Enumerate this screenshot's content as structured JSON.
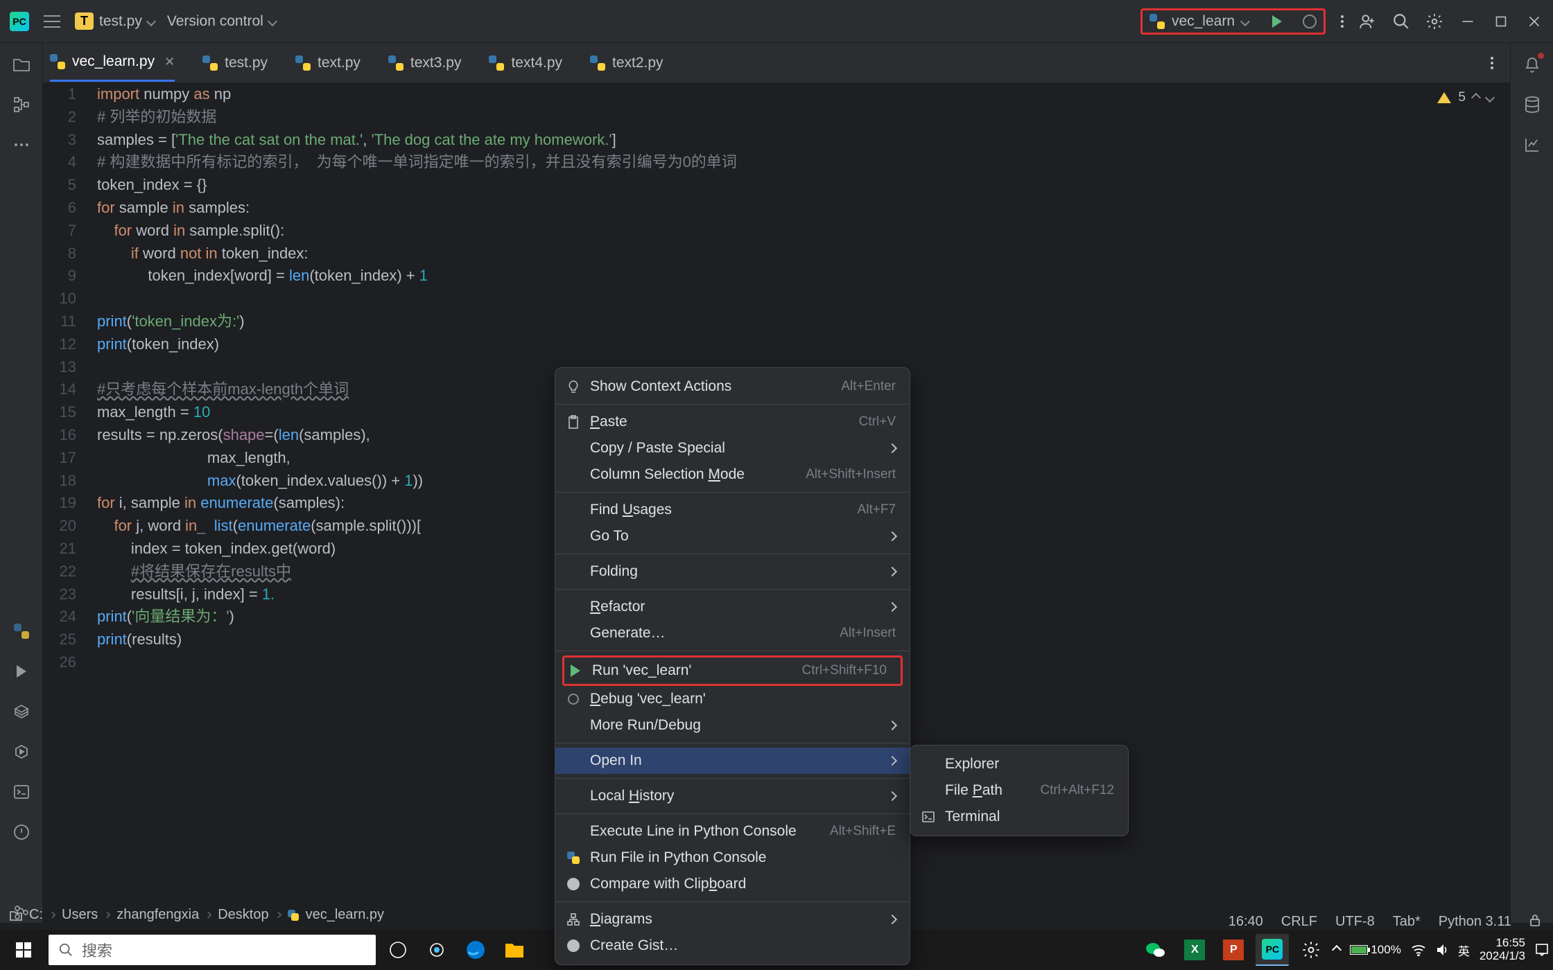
{
  "titlebar": {
    "project_badge": "T",
    "project_name": "test.py",
    "vcs_label": "Version control",
    "run_config": "vec_learn"
  },
  "tabs": [
    {
      "label": "vec_learn.py",
      "active": true
    },
    {
      "label": "test.py",
      "active": false
    },
    {
      "label": "text.py",
      "active": false
    },
    {
      "label": "text3.py",
      "active": false
    },
    {
      "label": "text4.py",
      "active": false
    },
    {
      "label": "text2.py",
      "active": false
    }
  ],
  "warnings": {
    "count": "5"
  },
  "code": {
    "lines": [
      {
        "n": "1",
        "html": "<span class='kw'>import</span> numpy <span class='kw'>as</span> np"
      },
      {
        "n": "2",
        "html": "<span class='cmt'># 列举的初始数据</span>"
      },
      {
        "n": "3",
        "html": "samples = [<span class='str'>'The the cat sat on the mat.'</span>, <span class='str'>'The dog cat the ate my homework.'</span>]"
      },
      {
        "n": "4",
        "html": "<span class='cmt'># 构建数据中所有标记的索引，  为每个唯一单词指定唯一的索引，并且没有索引编号为0的单词</span>"
      },
      {
        "n": "5",
        "html": "token_index = {}"
      },
      {
        "n": "6",
        "html": "<span class='kw'>for</span> sample <span class='kw'>in</span> samples:"
      },
      {
        "n": "7",
        "html": "    <span class='kw'>for</span> word <span class='kw'>in</span> sample.split():"
      },
      {
        "n": "8",
        "html": "        <span class='kw'>if</span> word <span class='kw'>not in</span> token_index:"
      },
      {
        "n": "9",
        "html": "            token_index[word] = <span class='fn'>len</span>(token_index) + <span class='num'>1</span>"
      },
      {
        "n": "10",
        "html": ""
      },
      {
        "n": "11",
        "html": "<span class='fn'>print</span>(<span class='str'>'token_index为:'</span>)"
      },
      {
        "n": "12",
        "html": "<span class='fn'>print</span>(token_index)"
      },
      {
        "n": "13",
        "html": ""
      },
      {
        "n": "14",
        "html": "<span class='cmt wavy'>#只考虑每个样本前max-length个单词</span>"
      },
      {
        "n": "15",
        "html": "max_length = <span class='num'>10</span>"
      },
      {
        "n": "16",
        "html": "results = np.zeros(<span style='color:#aa7ea3'>shape</span>=(<span class='fn'>len</span>(samples),",
        "hl": true
      },
      {
        "n": "17",
        "html": "                          max_length,"
      },
      {
        "n": "18",
        "html": "                          <span class='fn'>max</span>(token_index.values()) + <span class='num'>1</span>))"
      },
      {
        "n": "19",
        "html": "<span class='kw'>for</span> i, sample <span class='kw'>in</span> <span class='fn'>enumerate</span>(samples):"
      },
      {
        "n": "20",
        "html": "    <span class='kw'>for</span> j, word <span class='kw'>in</span><span class='cmt'>_</span>  <span class='fn'>list</span>(<span class='fn'>enumerate</span>(sample.split()))["
      },
      {
        "n": "21",
        "html": "        index = token_index.get(word)"
      },
      {
        "n": "22",
        "html": "        <span class='cmt wavy'>#将结果保存在results中</span>"
      },
      {
        "n": "23",
        "html": "        results[i, j, index] = <span class='num'>1.</span>"
      },
      {
        "n": "24",
        "html": "<span class='fn'>print</span>(<span class='str'>'向量结果为：'</span>)"
      },
      {
        "n": "25",
        "html": "<span class='fn'>print</span>(results)"
      },
      {
        "n": "26",
        "html": ""
      }
    ]
  },
  "context_menu": {
    "items": [
      {
        "type": "item",
        "icon": "bulb",
        "label": "Show Context Actions",
        "shortcut": "Alt+Enter"
      },
      {
        "type": "sep"
      },
      {
        "type": "item",
        "icon": "paste",
        "label_html": "<span class='u'>P</span>aste",
        "shortcut": "Ctrl+V"
      },
      {
        "type": "item",
        "label": "Copy / Paste Special",
        "arrow": true
      },
      {
        "type": "item",
        "label_html": "Column Selection <span class='u'>M</span>ode",
        "shortcut": "Alt+Shift+Insert"
      },
      {
        "type": "sep"
      },
      {
        "type": "item",
        "label_html": "Find <span class='u'>U</span>sages",
        "shortcut": "Alt+F7"
      },
      {
        "type": "item",
        "label": "Go To",
        "arrow": true
      },
      {
        "type": "sep"
      },
      {
        "type": "item",
        "label": "Folding",
        "arrow": true
      },
      {
        "type": "sep"
      },
      {
        "type": "item",
        "label_html": "<span class='u'>R</span>efactor",
        "arrow": true
      },
      {
        "type": "item",
        "label": "Generate…",
        "shortcut": "Alt+Insert"
      },
      {
        "type": "sep"
      },
      {
        "type": "run",
        "icon": "play",
        "label": "Run 'vec_learn'",
        "shortcut": "Ctrl+Shift+F10"
      },
      {
        "type": "item",
        "icon": "bug",
        "label_html": "<span class='u'>D</span>ebug 'vec_learn'"
      },
      {
        "type": "item",
        "label": "More Run/Debug",
        "arrow": true
      },
      {
        "type": "sep"
      },
      {
        "type": "item",
        "label": "Open In",
        "arrow": true,
        "selected": true
      },
      {
        "type": "sep"
      },
      {
        "type": "item",
        "label_html": "Local <span class='u'>H</span>istory",
        "arrow": true
      },
      {
        "type": "sep"
      },
      {
        "type": "item",
        "label": "Execute Line in Python Console",
        "shortcut": "Alt+Shift+E"
      },
      {
        "type": "item",
        "icon": "python",
        "label": "Run File in Python Console"
      },
      {
        "type": "item",
        "icon": "github",
        "label_html": "Compare with Clip<span class='u'>b</span>oard"
      },
      {
        "type": "sep"
      },
      {
        "type": "item",
        "icon": "diagram",
        "label_html": "<span class='u'>D</span>iagrams",
        "arrow": true
      },
      {
        "type": "item",
        "icon": "github",
        "label": "Create Gist…"
      }
    ]
  },
  "submenu": {
    "items": [
      {
        "label": "Explorer"
      },
      {
        "label_html": "File <span class='u'>P</span>ath",
        "shortcut": "Ctrl+Alt+F12"
      },
      {
        "icon": "terminal",
        "label": "Terminal"
      }
    ]
  },
  "breadcrumb": [
    "C:",
    "Users",
    "zhangfengxia",
    "Desktop",
    "vec_learn.py"
  ],
  "statusbar": {
    "time": "16:40",
    "line_ending": "CRLF",
    "encoding": "UTF-8",
    "indent": "Tab*",
    "interpreter": "Python 3.11"
  },
  "taskbar": {
    "search_placeholder": "搜索",
    "tray": {
      "battery": "100%",
      "ime": "英",
      "time": "16:55",
      "date": "2024/1/3"
    }
  }
}
